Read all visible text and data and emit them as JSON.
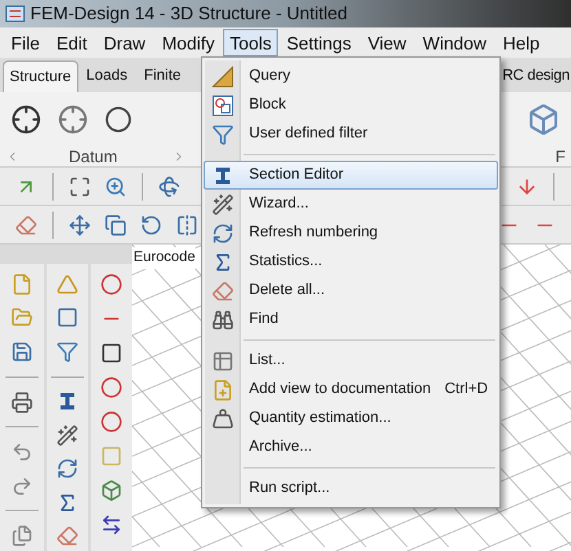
{
  "window": {
    "title": "FEM-Design 14 - 3D Structure - Untitled"
  },
  "menu_bar": [
    {
      "label": "File",
      "selected": false
    },
    {
      "label": "Edit",
      "selected": false
    },
    {
      "label": "Draw",
      "selected": false
    },
    {
      "label": "Modify",
      "selected": false
    },
    {
      "label": "Tools",
      "selected": true
    },
    {
      "label": "Settings",
      "selected": false
    },
    {
      "label": "View",
      "selected": false
    },
    {
      "label": "Window",
      "selected": false
    },
    {
      "label": "Help",
      "selected": false
    }
  ],
  "ribbon_tabs": [
    {
      "label": "Structure",
      "selected": true
    },
    {
      "label": "Loads",
      "selected": false
    },
    {
      "label": "Finite",
      "selected": false
    }
  ],
  "ribbon_tab_right": {
    "label": "RC design"
  },
  "ribbon_groups": [
    {
      "label": "Datum"
    },
    {
      "label": "F"
    }
  ],
  "canvas": {
    "label": "Eurocode"
  },
  "tools_menu": [
    {
      "kind": "item",
      "label": "Query",
      "selected": false
    },
    {
      "kind": "item",
      "label": "Block",
      "selected": false
    },
    {
      "kind": "item",
      "label": "User defined filter",
      "selected": false
    },
    {
      "kind": "separator"
    },
    {
      "kind": "item",
      "label": "Section Editor",
      "selected": true
    },
    {
      "kind": "item",
      "label": "Wizard...",
      "selected": false
    },
    {
      "kind": "item",
      "label": "Refresh numbering",
      "selected": false
    },
    {
      "kind": "item",
      "label": "Statistics...",
      "selected": false
    },
    {
      "kind": "item",
      "label": "Delete all...",
      "selected": false
    },
    {
      "kind": "item",
      "label": "Find",
      "selected": false
    },
    {
      "kind": "separator"
    },
    {
      "kind": "item",
      "label": "List...",
      "selected": false
    },
    {
      "kind": "item",
      "label": "Add view to documentation",
      "shortcut": "Ctrl+D",
      "selected": false
    },
    {
      "kind": "item",
      "label": "Quantity estimation...",
      "selected": false
    },
    {
      "kind": "item",
      "label": "Archive...",
      "selected": false
    },
    {
      "kind": "separator"
    },
    {
      "kind": "item",
      "label": "Run script...",
      "selected": false
    }
  ]
}
